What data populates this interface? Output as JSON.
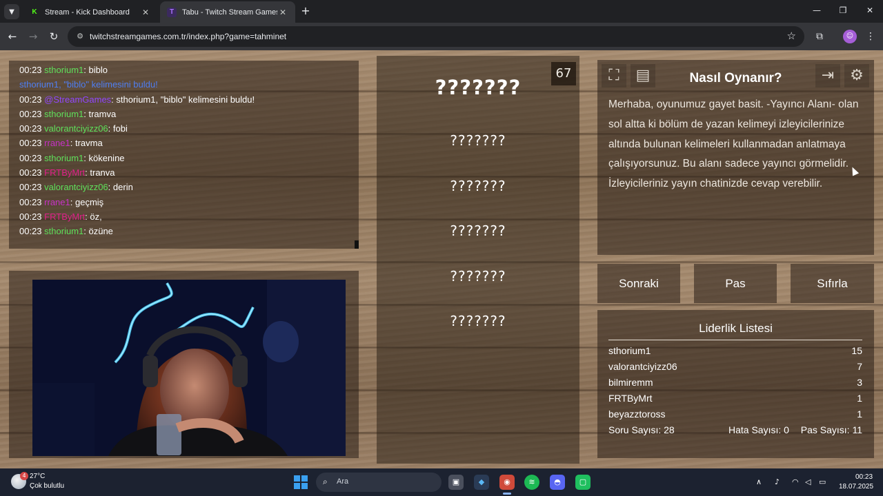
{
  "browser": {
    "tabs": [
      {
        "title": "Stream - Kick Dashboard",
        "favicon": "K"
      },
      {
        "title": "Tabu - Twitch Stream Games",
        "favicon": "T"
      }
    ],
    "url": "twitchstreamgames.com.tr/index.php?game=tahminet"
  },
  "chat": {
    "lines": [
      {
        "time": "00:23",
        "user": "sthorium1",
        "sep": ": ",
        "msg": "biblo",
        "userColor": "#5ee05a",
        "msgColor": "#ffffff"
      },
      {
        "time": "",
        "user": "sthorium1, ",
        "sep": "",
        "msg": "\"biblo\" kelimesini buldu!",
        "userColor": "#4f7ef2",
        "msgColor": "#4f7ef2"
      },
      {
        "time": "00:23",
        "user": "@StreamGames",
        "sep": ": ",
        "msg": "sthorium1, \"biblo\" kelimesini buldu!",
        "userColor": "#9146ff",
        "msgColor": "#ffffff"
      },
      {
        "time": "00:23",
        "user": "sthorium1",
        "sep": ": ",
        "msg": "tramva",
        "userColor": "#5ee05a",
        "msgColor": "#ffffff"
      },
      {
        "time": "00:23",
        "user": "valorantciyizz06",
        "sep": ": ",
        "msg": "fobi",
        "userColor": "#5ee05a",
        "msgColor": "#ffffff"
      },
      {
        "time": "00:23",
        "user": "rrane1",
        "sep": ": ",
        "msg": "travma",
        "userColor": "#c832c8",
        "msgColor": "#ffffff"
      },
      {
        "time": "00:23",
        "user": "sthorium1",
        "sep": ": ",
        "msg": "kökenine",
        "userColor": "#5ee05a",
        "msgColor": "#ffffff"
      },
      {
        "time": "00:23",
        "user": "FRTByMrt",
        "sep": ": ",
        "msg": "tranva",
        "userColor": "#e0208a",
        "msgColor": "#ffffff"
      },
      {
        "time": "00:23",
        "user": "valorantciyizz06",
        "sep": ": ",
        "msg": "derin",
        "userColor": "#5ee05a",
        "msgColor": "#ffffff"
      },
      {
        "time": "00:23",
        "user": "rrane1",
        "sep": ": ",
        "msg": "geçmiş",
        "userColor": "#c832c8",
        "msgColor": "#ffffff"
      },
      {
        "time": "00:23",
        "user": "FRTByMrt",
        "sep": ": ",
        "msg": "öz,",
        "userColor": "#e0208a",
        "msgColor": "#ffffff"
      },
      {
        "time": "00:23",
        "user": "sthorium1",
        "sep": ": ",
        "msg": "özüne",
        "userColor": "#5ee05a",
        "msgColor": "#ffffff"
      }
    ]
  },
  "game": {
    "timer": "67",
    "main_word": "???????",
    "taboo_words": [
      "???????",
      "???????",
      "???????",
      "???????",
      "???????"
    ]
  },
  "help": {
    "title": "Nasıl Oynanır?",
    "text": "Merhaba, oyunumuz gayet basit. -Yayıncı Alanı- olan sol altta ki bölüm de yazan kelimeyi izleyicilerinize altında bulunan kelimeleri kullanmadan anlatmaya çalışıyorsunuz. Bu alanı sadece yayıncı görmelidir. İzleyicileriniz yayın chatinizde cevap verebilir."
  },
  "controls": {
    "next": "Sonraki",
    "pass": "Pas",
    "reset": "Sıfırla"
  },
  "leaderboard": {
    "title": "Liderlik Listesi",
    "rows": [
      {
        "name": "sthorium1",
        "score": "15"
      },
      {
        "name": "valorantciyizz06",
        "score": "7"
      },
      {
        "name": "bilmiremm",
        "score": "3"
      },
      {
        "name": "FRTByMrt",
        "score": "1"
      },
      {
        "name": "beyazztoross",
        "score": "1"
      }
    ],
    "questions": "Soru Sayısı: 28",
    "errors": "Hata Sayısı: 0",
    "passes": "Pas Sayısı: 11"
  },
  "taskbar": {
    "temperature": "27°C",
    "weather": "Çok bulutlu",
    "weather_badge": "4",
    "search_placeholder": "Ara",
    "time": "00:23",
    "date": "18.07.2025"
  }
}
